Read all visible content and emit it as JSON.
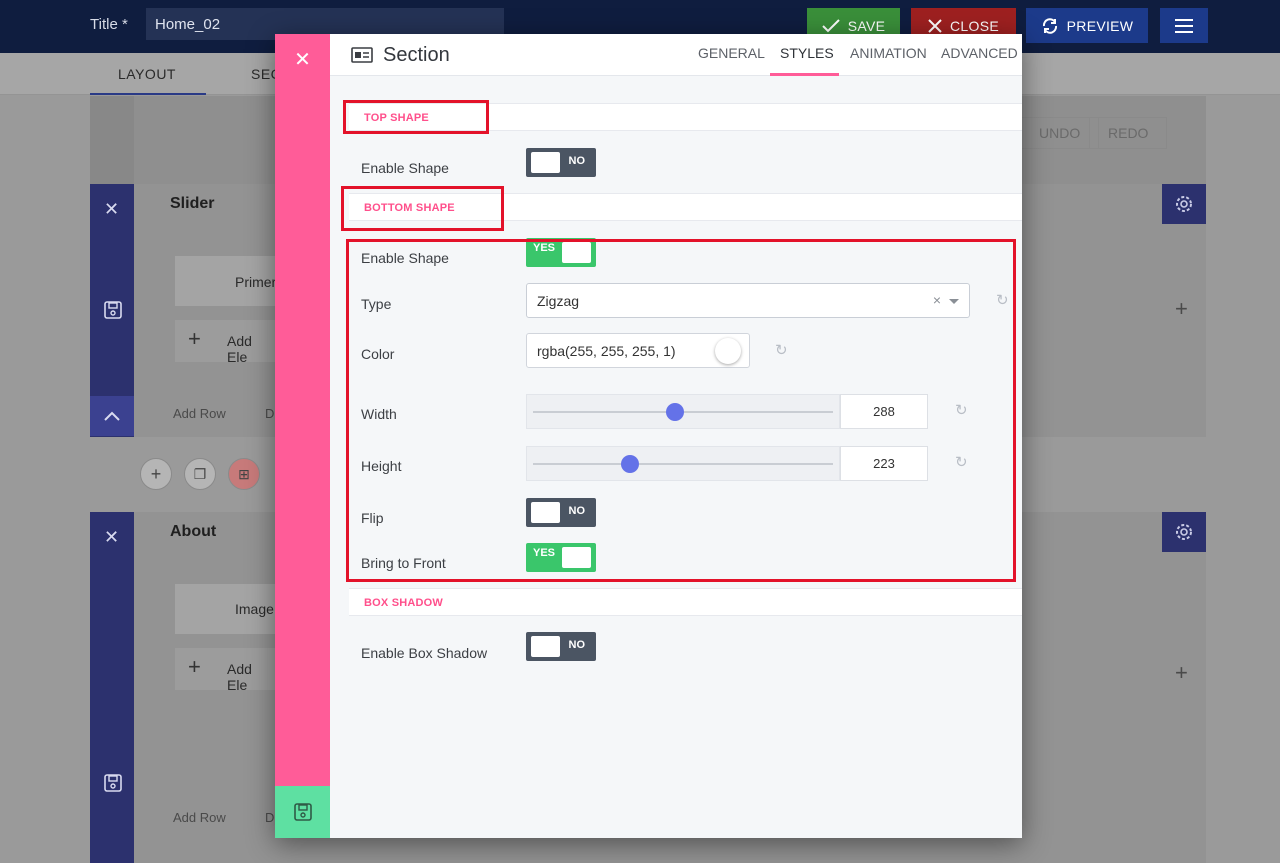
{
  "topbar": {
    "title_label": "Title *",
    "title_value": "Home_02",
    "save_label": "SAVE",
    "close_label": "CLOSE",
    "preview_label": "PREVIEW"
  },
  "subtabs": [
    "LAYOUT",
    "SEC"
  ],
  "background": {
    "undo_label": "UNDO",
    "redo_label": "REDO",
    "sections": [
      {
        "title": "Slider",
        "element": "Primer",
        "add_element": "Add Ele",
        "add_row": "Add Row",
        "dup": "D"
      },
      {
        "title": "About",
        "element": "Image",
        "add_element": "Add Ele",
        "add_row": "Add Row",
        "dup": "D"
      }
    ]
  },
  "modal": {
    "title": "Section",
    "tabs": [
      "GENERAL",
      "STYLES",
      "ANIMATION",
      "ADVANCED"
    ],
    "active_tab": "STYLES",
    "top_shape": {
      "header": "TOP SHAPE",
      "enable_label": "Enable Shape",
      "enable_value": "NO"
    },
    "bottom_shape": {
      "header": "BOTTOM SHAPE",
      "enable_label": "Enable Shape",
      "enable_value": "YES",
      "type_label": "Type",
      "type_value": "Zigzag",
      "color_label": "Color",
      "color_value": "rgba(255, 255, 255, 1)",
      "width_label": "Width",
      "width_value": "288",
      "width_fraction": 0.47,
      "height_label": "Height",
      "height_value": "223",
      "height_fraction": 0.32,
      "flip_label": "Flip",
      "flip_value": "NO",
      "front_label": "Bring to Front",
      "front_value": "YES"
    },
    "box_shadow": {
      "header": "BOX SHADOW",
      "enable_label": "Enable Box Shadow",
      "enable_value": "NO"
    }
  },
  "colors": {
    "accent": "#ff5c98",
    "toggle_on": "#3ac66b",
    "toggle_off": "#4b5563",
    "slider_thumb": "#6472e8",
    "highlight": "#e3122a"
  }
}
